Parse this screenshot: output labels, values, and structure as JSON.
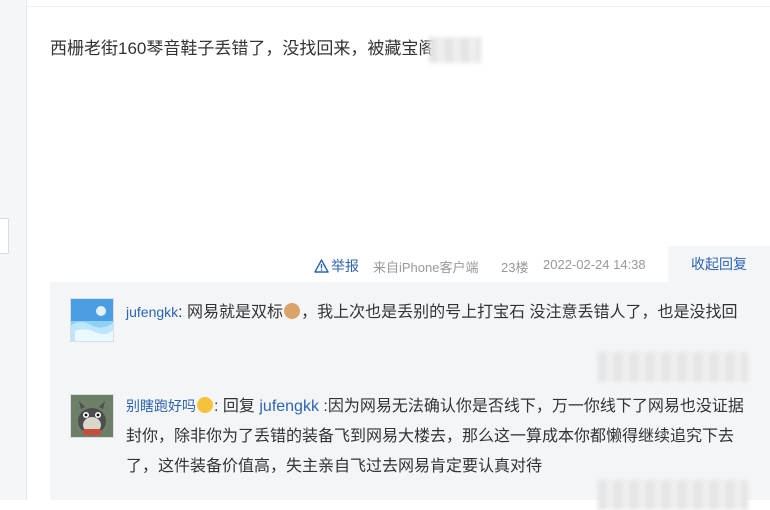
{
  "post": {
    "content": "西栅老街160琴音鞋子丢错了，没找回来，被藏宝阁"
  },
  "meta": {
    "report_label": "举报",
    "source": "来自iPhone客户端",
    "floor": "23楼",
    "timestamp": "2022-02-24 14:38",
    "collapse_label": "收起回复"
  },
  "replies": [
    {
      "username": "jufengkk",
      "separator": ":",
      "text_before_emoji": " 网易就是双标",
      "emoji": "dog-face-emoji",
      "text_after_emoji": "，我上次也是丢别的号上打宝石 没注意丢错人了，也是没找回"
    },
    {
      "username": "别瞎跑好吗",
      "emoji": "kiss-face-emoji",
      "separator": ":",
      "reply_prefix": " 回复 ",
      "reply_to": "jufengkk",
      "text": " :因为网易无法确认你是否线下，万一你线下了网易也没证据封你，除非你为了丢错的装备飞到网易大楼去，那么这一算成本你都懒得继续追究下去了，这件装备价值高，失主亲自飞过去网易肯定要认真对待"
    }
  ],
  "colors": {
    "link": "#2d64b3",
    "reply_bg": "#f3f5f7",
    "meta_text": "#999999"
  }
}
